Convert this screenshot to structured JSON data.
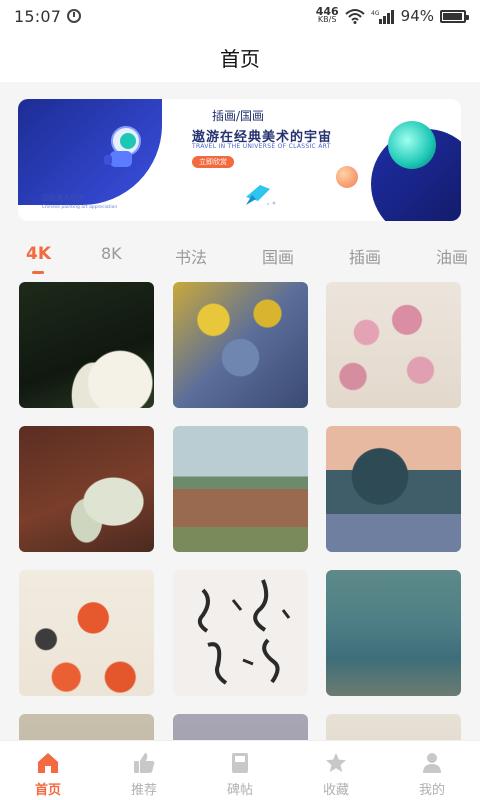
{
  "status_bar": {
    "time": "15:07",
    "net_speed_value": "446",
    "net_speed_unit": "KB/S",
    "network_type": "4G",
    "battery_percent": "94%",
    "battery_level": 0.94
  },
  "header": {
    "title": "首页"
  },
  "banner": {
    "title_line1": "插画/国画",
    "title_line2": "遨游在经典美术的宇宙",
    "subtitle_en": "TRAVEL IN THE UNIVERSE OF CLASSIC ART",
    "button_label": "立即欣赏",
    "caption": "国画美术欣赏",
    "caption_en": "Chinese painting art appreciation"
  },
  "tabs": [
    {
      "label": "4K",
      "active": true
    },
    {
      "label": "8K",
      "active": false
    },
    {
      "label": "书法",
      "active": false
    },
    {
      "label": "国画",
      "active": false
    },
    {
      "label": "插画",
      "active": false
    },
    {
      "label": "油画",
      "active": false
    }
  ],
  "bottom_nav": [
    {
      "label": "首页",
      "icon": "home-icon",
      "active": true
    },
    {
      "label": "推荐",
      "icon": "thumbs-up-icon",
      "active": false
    },
    {
      "label": "碑帖",
      "icon": "book-icon",
      "active": false
    },
    {
      "label": "收藏",
      "icon": "star-icon",
      "active": false
    },
    {
      "label": "我的",
      "icon": "person-icon",
      "active": false
    }
  ],
  "colors": {
    "accent": "#f26a3e",
    "inactive": "#b0b0b0",
    "background": "#f5f5f5"
  }
}
